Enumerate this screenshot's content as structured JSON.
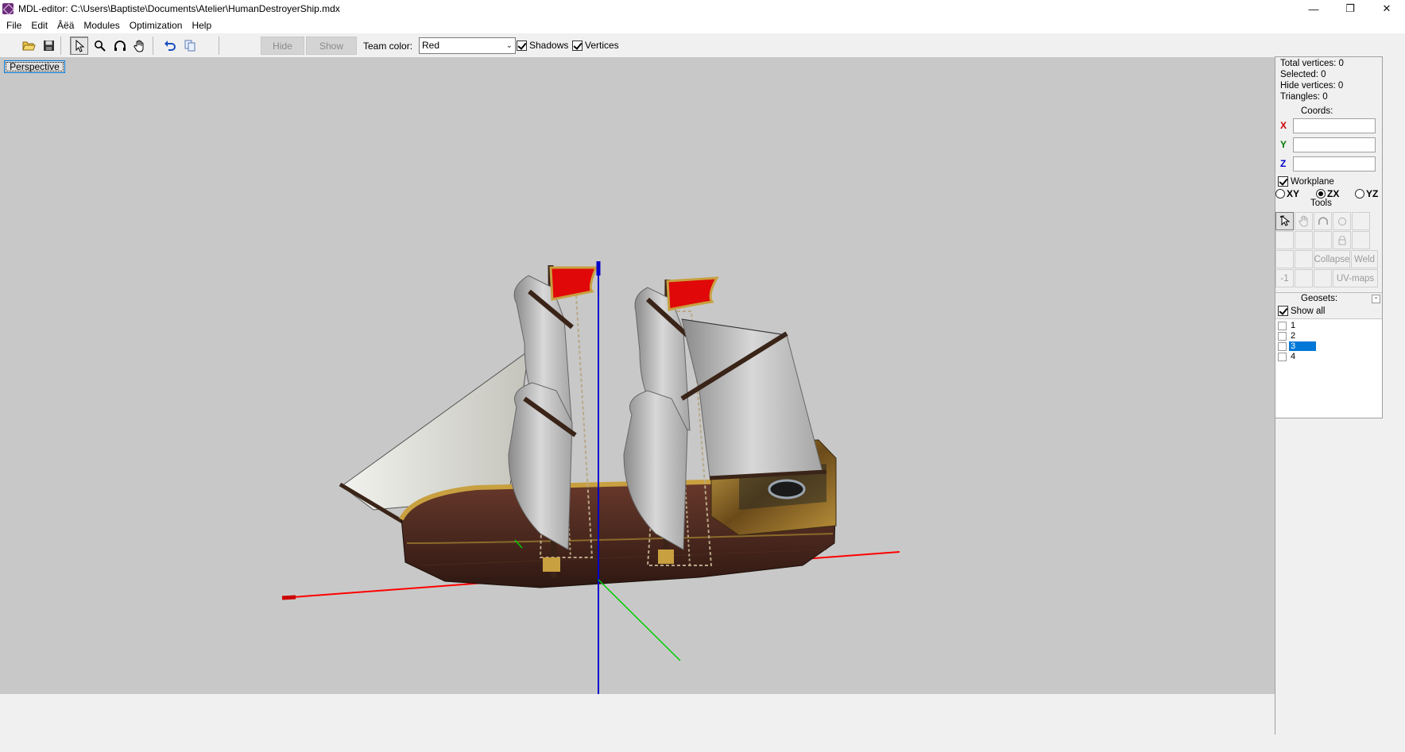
{
  "window": {
    "title": "MDL-editor: C:\\Users\\Baptiste\\Documents\\Atelier\\HumanDestroyerShip.mdx",
    "minimize": "—",
    "restore": "❐",
    "close": "✕"
  },
  "menu": {
    "items": [
      "File",
      "Edit",
      "Âëä",
      "Modules",
      "Optimization",
      "Help"
    ]
  },
  "toolbar": {
    "hide_label": "Hide",
    "show_label": "Show",
    "team_color_label": "Team color:",
    "team_color_value": "Red",
    "shadows_label": "Shadows",
    "shadows_checked": true,
    "vertices_label": "Vertices",
    "vertices_checked": true
  },
  "viewport": {
    "perspective_label": "Perspective",
    "background": "#c8c8c8",
    "axis_colors": {
      "x": "#ff0000",
      "y": "#00cc00",
      "z": "#0000cc"
    }
  },
  "panel": {
    "total_vertices": "Total vertices: 0",
    "selected": "Selected: 0",
    "hide_vertices": "Hide vertices: 0",
    "triangles": "Triangles: 0",
    "coords_title": "Coords:",
    "x_label": "X",
    "y_label": "Y",
    "z_label": "Z",
    "x_value": "",
    "y_value": "",
    "z_value": "",
    "workplane_label": "Workplane",
    "workplane_checked": true,
    "plane_xy": "XY",
    "plane_zx": "ZX",
    "plane_yz": "YZ",
    "plane_selected": "ZX",
    "tools_title": "Tools",
    "collapse_label": "Collapse",
    "weld_label": "Weld",
    "minus_one_label": "-1",
    "uvmaps_label": "UV-maps",
    "geosets_title": "Geosets:",
    "geosets_min": "-",
    "show_all_label": "Show all",
    "show_all_checked": true,
    "geosets": [
      "1",
      "2",
      "3",
      "4"
    ],
    "selected_geoset": "3"
  }
}
